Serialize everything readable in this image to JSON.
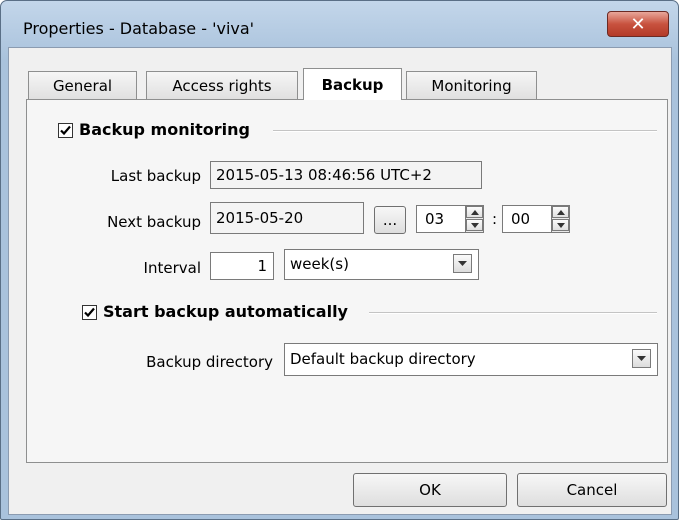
{
  "window": {
    "title": "Properties - Database - 'viva'",
    "close_icon": "close-icon"
  },
  "tabs": [
    {
      "label": "General",
      "active": false
    },
    {
      "label": "Access rights",
      "active": false
    },
    {
      "label": "Backup",
      "active": true
    },
    {
      "label": "Monitoring",
      "active": false
    }
  ],
  "backup_monitoring": {
    "label": "Backup monitoring",
    "checked": true,
    "last_backup_label": "Last backup",
    "last_backup_value": "2015-05-13 08:46:56 UTC+2",
    "next_backup_label": "Next backup",
    "next_backup_date": "2015-05-20",
    "browse_label": "...",
    "hour": "03",
    "time_separator": ":",
    "minute": "00",
    "interval_label": "Interval",
    "interval_value": "1",
    "interval_unit": "week(s)"
  },
  "auto_backup": {
    "label": "Start backup automatically",
    "checked": true,
    "directory_label": "Backup directory",
    "directory_value": "Default backup directory"
  },
  "buttons": {
    "ok": "OK",
    "cancel": "Cancel"
  }
}
